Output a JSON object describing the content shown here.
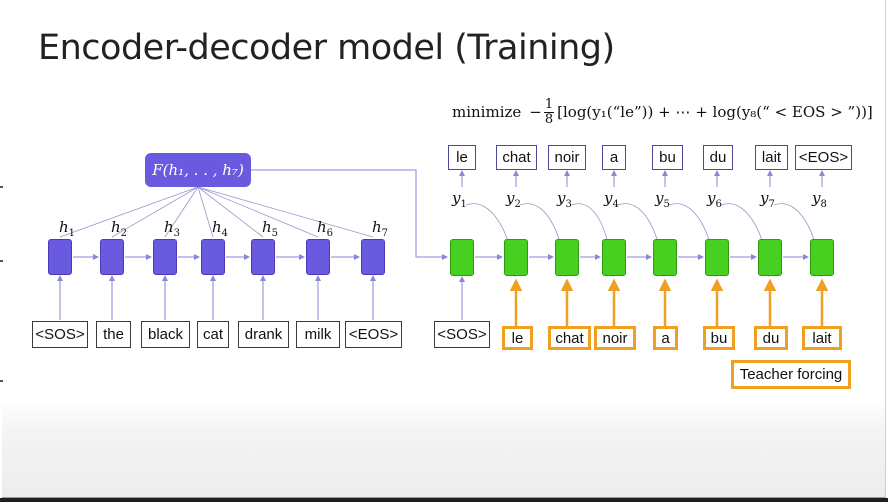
{
  "slide": {
    "title": "Encoder-decoder model (Training)",
    "formula": {
      "prefix": "minimize",
      "minus": "−",
      "frac_num": "1",
      "frac_den": "8",
      "body": "[log(y₁(“le”)) + ⋯ + log(y₈(“ < EOS > ”))]"
    }
  },
  "encoder": {
    "inputs": [
      "<SOS>",
      "the",
      "black",
      "cat",
      "drank",
      "milk",
      "<EOS>"
    ],
    "hidden": [
      {
        "sym": "h",
        "sub": "1"
      },
      {
        "sym": "h",
        "sub": "2"
      },
      {
        "sym": "h",
        "sub": "3"
      },
      {
        "sym": "h",
        "sub": "4"
      },
      {
        "sym": "h",
        "sub": "5"
      },
      {
        "sym": "h",
        "sub": "6"
      },
      {
        "sym": "h",
        "sub": "7"
      }
    ],
    "aggregate_label": "F(h₁, . . , h₇)"
  },
  "decoder": {
    "start_input": "<SOS>",
    "outputs": [
      "le",
      "chat",
      "noir",
      "a",
      "bu",
      "du",
      "lait",
      "<EOS>"
    ],
    "predictions": [
      {
        "sym": "y",
        "sub": "1"
      },
      {
        "sym": "y",
        "sub": "2"
      },
      {
        "sym": "y",
        "sub": "3"
      },
      {
        "sym": "y",
        "sub": "4"
      },
      {
        "sym": "y",
        "sub": "5"
      },
      {
        "sym": "y",
        "sub": "6"
      },
      {
        "sym": "y",
        "sub": "7"
      },
      {
        "sym": "y",
        "sub": "8"
      }
    ],
    "teacher_inputs": [
      "le",
      "chat",
      "noir",
      "a",
      "bu",
      "du",
      "lait"
    ],
    "teacher_forcing_label": "Teacher forcing"
  },
  "colors": {
    "encoder_cell": "#6a5ae0",
    "decoder_cell": "#48d020",
    "teacher_forcing": "#f0a020",
    "arrow": "#8a86d8"
  }
}
